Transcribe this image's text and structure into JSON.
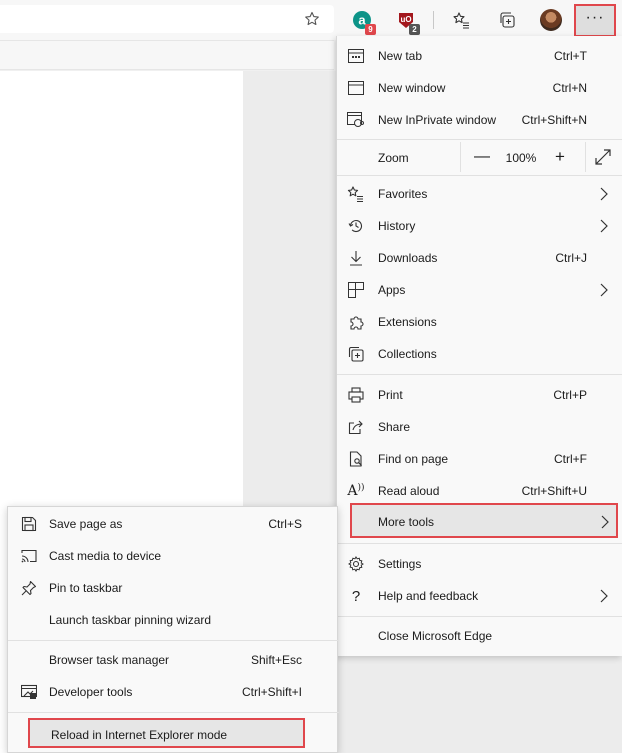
{
  "toolbar": {
    "favorite_icon": "star-outline-icon",
    "extensions": [
      {
        "name": "a-extension",
        "badge": "9",
        "color": "#0d9488",
        "badge_color": "#e0474c"
      },
      {
        "name": "u-extension",
        "badge": "2",
        "color": "#a3171d",
        "badge_color": "#555555"
      }
    ],
    "more_label": "···"
  },
  "menu": {
    "items": [
      {
        "label": "New tab",
        "shortcut": "Ctrl+T",
        "icon": "new-tab-icon"
      },
      {
        "label": "New window",
        "shortcut": "Ctrl+N",
        "icon": "new-window-icon"
      },
      {
        "label": "New InPrivate window",
        "shortcut": "Ctrl+Shift+N",
        "icon": "inprivate-icon"
      }
    ],
    "zoom": {
      "label": "Zoom",
      "minus": "—",
      "value": "100%",
      "plus": "+"
    },
    "items2": [
      {
        "label": "Favorites",
        "icon": "favorites-icon"
      },
      {
        "label": "History",
        "icon": "history-icon"
      },
      {
        "label": "Downloads",
        "shortcut": "Ctrl+J",
        "icon": "download-icon"
      },
      {
        "label": "Apps",
        "icon": "apps-icon"
      },
      {
        "label": "Extensions",
        "icon": "extensions-icon"
      },
      {
        "label": "Collections",
        "icon": "collections-icon"
      }
    ],
    "items3": [
      {
        "label": "Print",
        "shortcut": "Ctrl+P",
        "icon": "print-icon"
      },
      {
        "label": "Share",
        "icon": "share-icon"
      },
      {
        "label": "Find on page",
        "shortcut": "Ctrl+F",
        "icon": "find-icon"
      },
      {
        "label": "Read aloud",
        "shortcut": "Ctrl+Shift+U",
        "icon": "read-aloud-icon",
        "icon_text": "A"
      },
      {
        "label": "More tools",
        "icon": "more-tools-icon"
      }
    ],
    "items4": [
      {
        "label": "Settings",
        "icon": "gear-icon"
      },
      {
        "label": "Help and feedback",
        "icon": "help-icon",
        "icon_text": "?"
      }
    ],
    "close": {
      "label": "Close Microsoft Edge"
    }
  },
  "submenu": {
    "items": [
      {
        "label": "Save page as",
        "shortcut": "Ctrl+S",
        "icon": "save-icon"
      },
      {
        "label": "Cast media to device",
        "icon": "cast-icon"
      },
      {
        "label": "Pin to taskbar",
        "icon": "pin-icon"
      },
      {
        "label": "Launch taskbar pinning wizard"
      }
    ],
    "items2": [
      {
        "label": "Browser task manager",
        "shortcut": "Shift+Esc"
      },
      {
        "label": "Developer tools",
        "shortcut": "Ctrl+Shift+I",
        "icon": "developer-tools-icon"
      }
    ],
    "reload": {
      "label": "Reload in Internet Explorer mode"
    }
  },
  "colors": {
    "highlight": "#e0474c",
    "menu_bg": "#f9f9f9",
    "hover_bg": "#e6e6e6"
  }
}
